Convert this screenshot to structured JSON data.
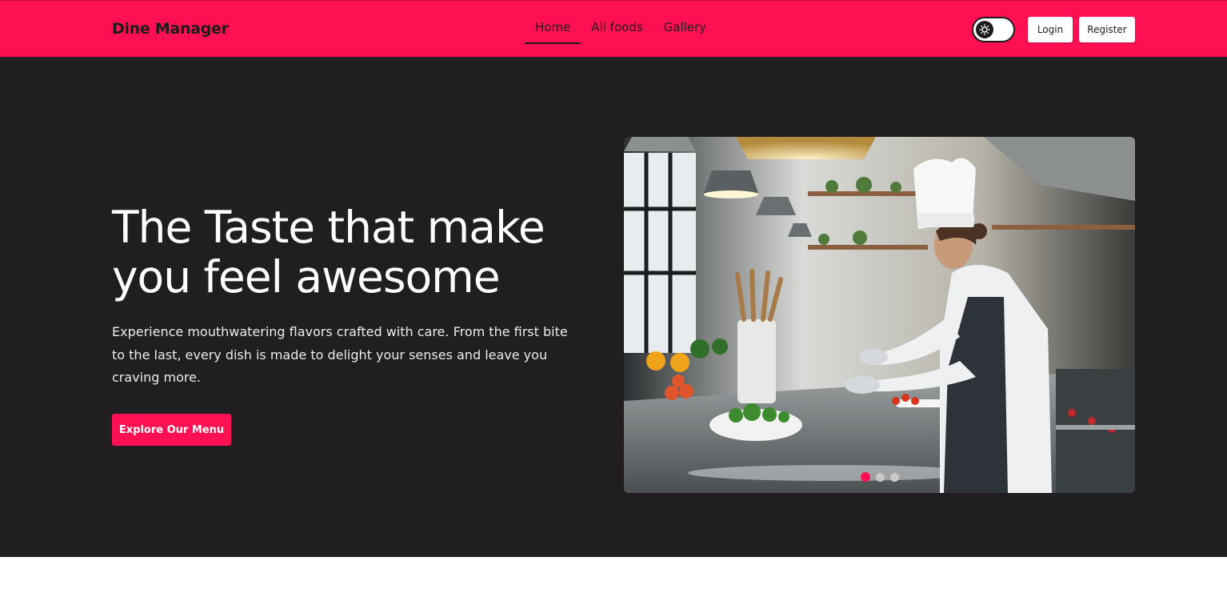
{
  "brand": "Dine Manager",
  "nav": {
    "items": [
      {
        "label": "Home",
        "active": true
      },
      {
        "label": "All foods",
        "active": false
      },
      {
        "label": "Gallery",
        "active": false
      }
    ]
  },
  "theme_toggle": {
    "icon": "sun-icon"
  },
  "auth": {
    "login_label": "Login",
    "register_label": "Register"
  },
  "hero": {
    "title": "The Taste that make you feel awesome",
    "description": "Experience mouthwatering flavors crafted with care. From the first bite to the last, every dish is made to delight your senses and leave you craving more.",
    "cta_label": "Explore Our Menu"
  },
  "carousel": {
    "image": "chef-in-kitchen-photo",
    "slide_count": 3,
    "active_slide": 1
  },
  "colors": {
    "accent": "#ff1053",
    "hero_bg": "#201e20",
    "text_dark": "#1c1c1c"
  }
}
